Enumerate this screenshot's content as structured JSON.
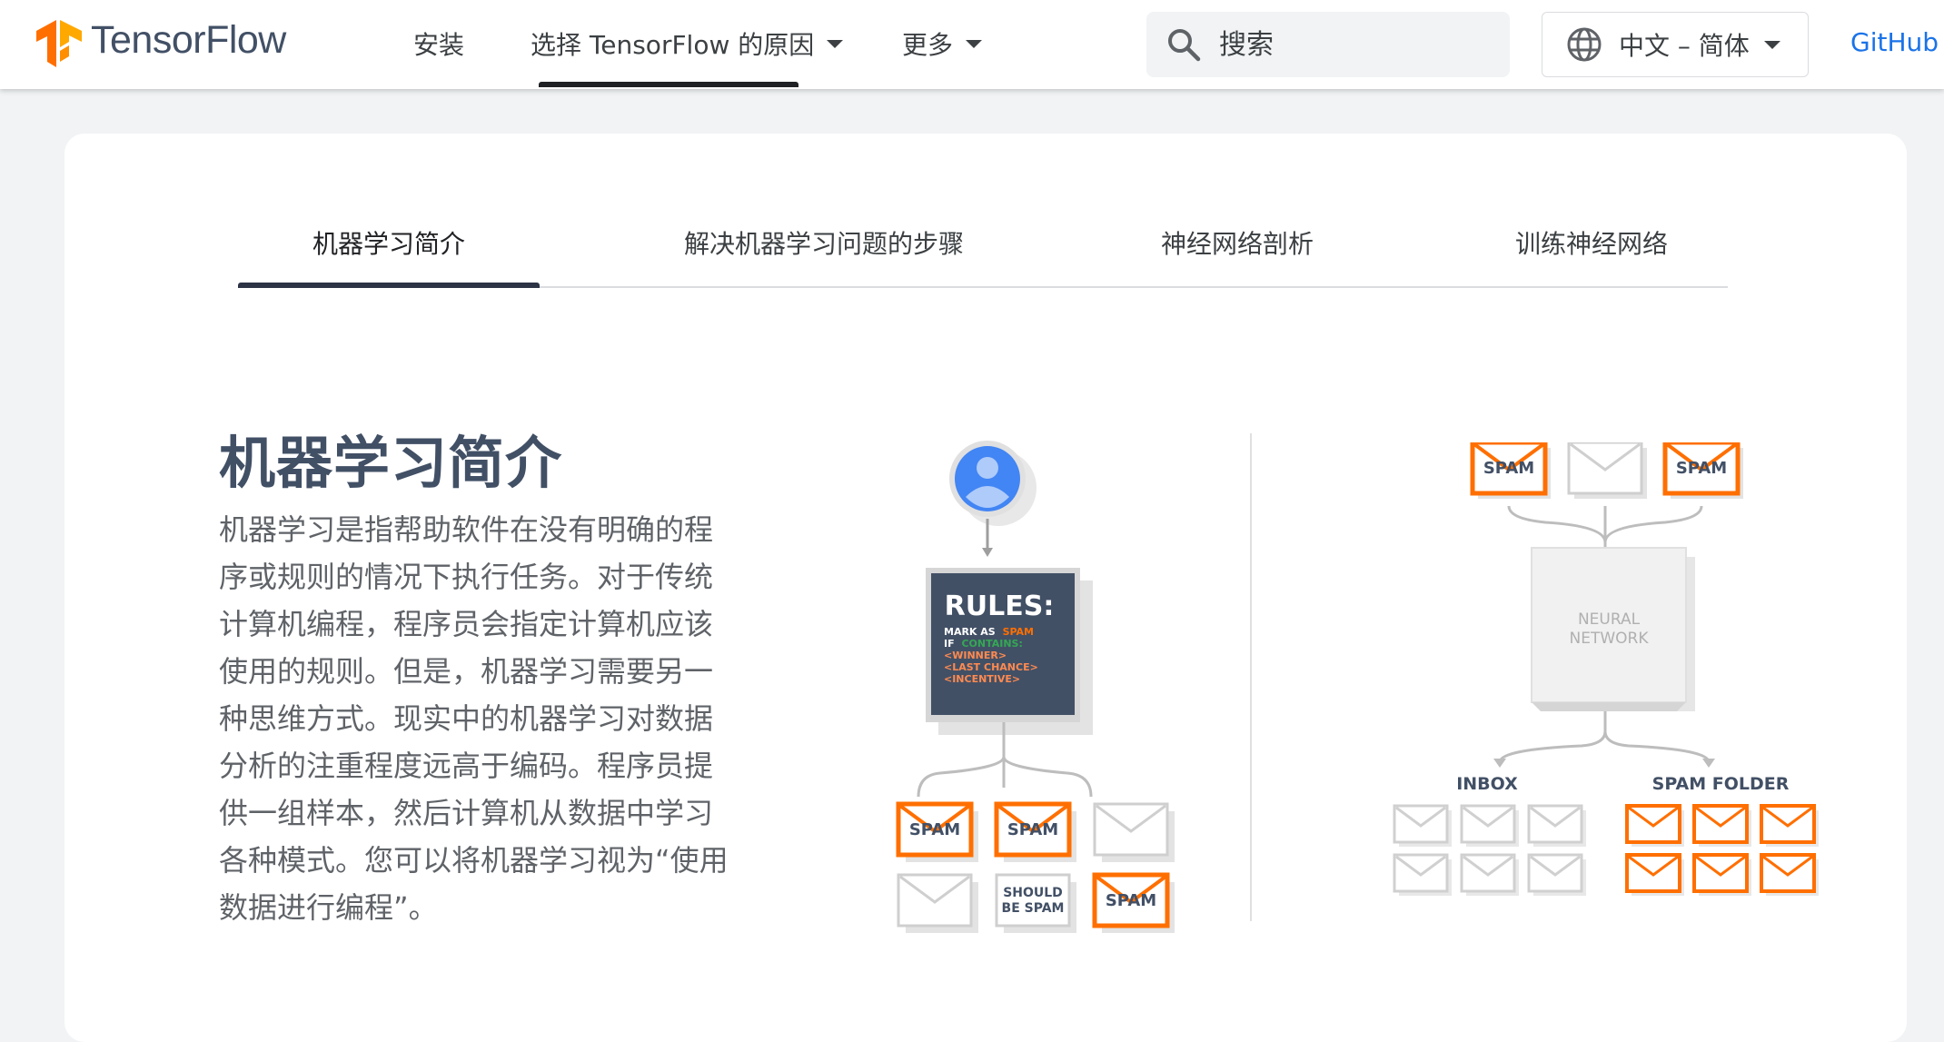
{
  "header": {
    "brand": "TensorFlow",
    "nav": {
      "install": "安装",
      "why": "选择 TensorFlow 的原因",
      "more": "更多"
    },
    "search_placeholder": "搜索",
    "language": "中文 – 简体",
    "github": "GitHub"
  },
  "tabs": [
    {
      "label": "机器学习简介"
    },
    {
      "label": "解决机器学习问题的步骤"
    },
    {
      "label": "神经网络剖析"
    },
    {
      "label": "训练神经网络"
    }
  ],
  "content": {
    "title": "机器学习简介",
    "lines": [
      "机器学习是指帮助软件在没有明确的程",
      "序或规则的情况下执行任务。对于传统",
      "计算机编程，程序员会指定计算机应该",
      "使用的规则。但是，机器学习需要另一",
      "种思维方式。现实中的机器学习对数据",
      "分析的注重程度远高于编码。程序员提",
      "供一组样本，然后计算机从数据中学习",
      "各种模式。您可以将机器学习视为“使用",
      "数据进行编程”。"
    ]
  },
  "illustration": {
    "rules_title": "RULES:",
    "rules_mark": "MARK AS",
    "rules_spam": "SPAM",
    "rules_if": "IF",
    "rules_contains": "CONTAINS:",
    "rules_winner": "<WINNER>",
    "rules_last_chance": "<LAST CHANCE>",
    "rules_incentive": "<INCENTIVE>",
    "spam_label": "SPAM",
    "should_be_spam_1": "SHOULD",
    "should_be_spam_2": "BE SPAM",
    "neural_1": "NEURAL",
    "neural_2": "NETWORK",
    "inbox": "INBOX",
    "spam_folder": "SPAM FOLDER"
  },
  "colors": {
    "accent_orange": "#ff6f00",
    "brand_blue": "#1a73e8",
    "rules_green": "#34a853",
    "rules_box": "#425066"
  }
}
